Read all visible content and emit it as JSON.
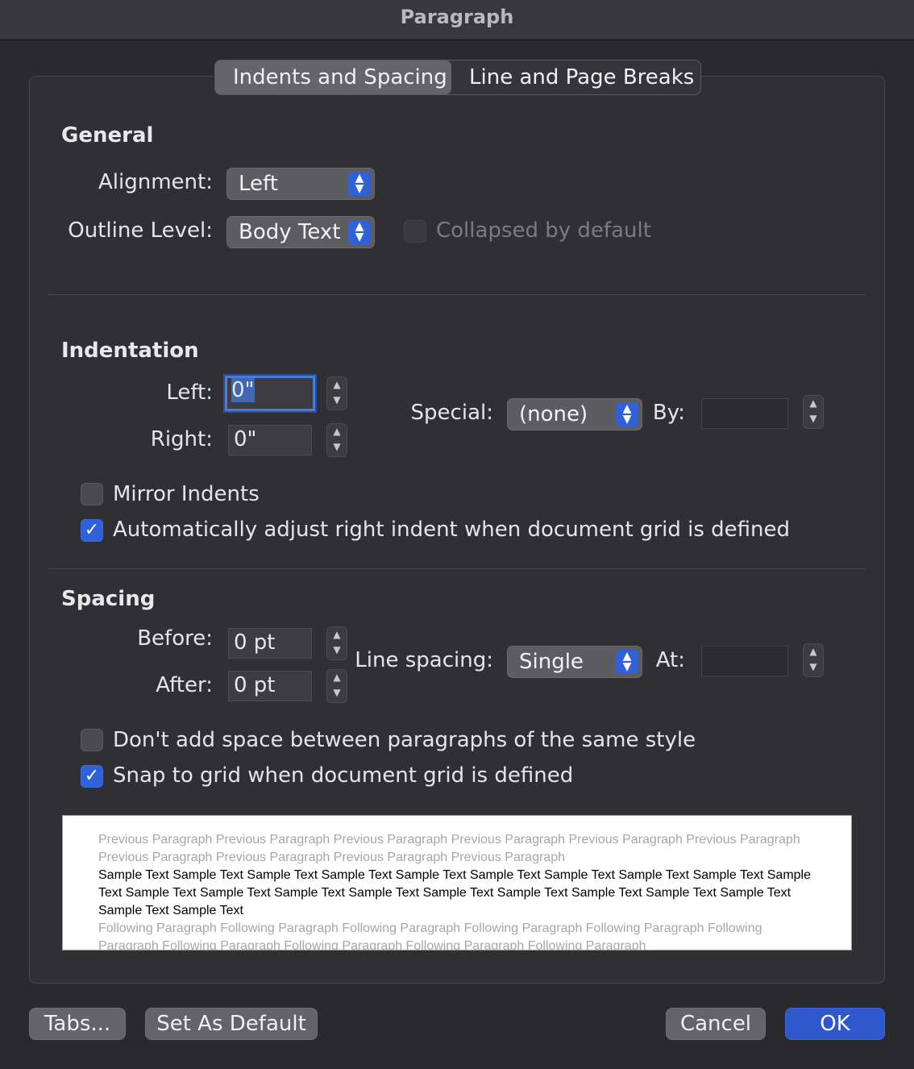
{
  "window": {
    "title": "Paragraph"
  },
  "tabs": [
    {
      "label": "Indents and Spacing",
      "active": true
    },
    {
      "label": "Line and Page Breaks",
      "active": false
    }
  ],
  "general": {
    "title": "General",
    "alignment": {
      "label": "Alignment:",
      "value": "Left"
    },
    "outline_level": {
      "label": "Outline Level:",
      "value": "Body Text"
    },
    "collapsed": {
      "label": "Collapsed by default",
      "checked": false,
      "enabled": false
    }
  },
  "indentation": {
    "title": "Indentation",
    "left": {
      "label": "Left:",
      "value": "0\""
    },
    "right": {
      "label": "Right:",
      "value": "0\""
    },
    "special": {
      "label": "Special:",
      "value": "(none)"
    },
    "by": {
      "label": "By:",
      "value": ""
    },
    "mirror_indents": {
      "label": "Mirror Indents",
      "checked": false
    },
    "auto_adjust": {
      "label": "Automatically adjust right indent when document grid is defined",
      "checked": true
    }
  },
  "spacing": {
    "title": "Spacing",
    "before": {
      "label": "Before:",
      "value": "0 pt"
    },
    "after": {
      "label": "After:",
      "value": "0 pt"
    },
    "line_spacing": {
      "label": "Line spacing:",
      "value": "Single"
    },
    "at": {
      "label": "At:",
      "value": ""
    },
    "dont_add_space": {
      "label": "Don't add space between paragraphs of the same style",
      "checked": false
    },
    "snap_to_grid": {
      "label": "Snap to grid when document grid is defined",
      "checked": true
    }
  },
  "preview": {
    "previous": "Previous Paragraph Previous Paragraph Previous Paragraph Previous Paragraph Previous Paragraph Previous Paragraph Previous Paragraph Previous Paragraph Previous Paragraph Previous Paragraph",
    "sample": "Sample Text Sample Text Sample Text Sample Text Sample Text Sample Text Sample Text Sample Text Sample Text Sample Text Sample Text Sample Text Sample Text Sample Text Sample Text Sample Text Sample Text Sample Text Sample Text Sample Text Sample Text",
    "following": "Following Paragraph Following Paragraph Following Paragraph Following Paragraph Following Paragraph Following Paragraph Following Paragraph Following Paragraph Following Paragraph Following Paragraph"
  },
  "buttons": {
    "tabs": "Tabs...",
    "set_default": "Set As Default",
    "cancel": "Cancel",
    "ok": "OK"
  },
  "colors": {
    "accent": "#2f62d9",
    "primary_button": "#2f58cc"
  }
}
